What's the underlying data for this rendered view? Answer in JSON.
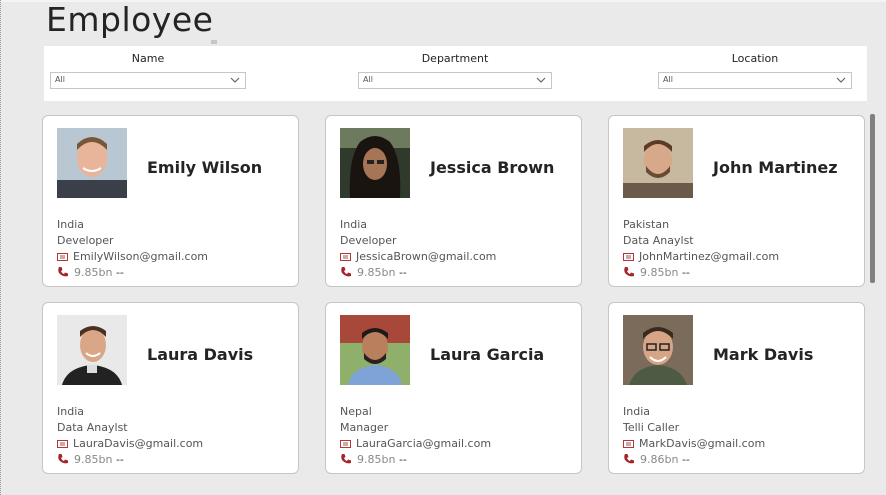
{
  "page": {
    "title": "Employee"
  },
  "filters": [
    {
      "label": "Name",
      "value": "All"
    },
    {
      "label": "Department",
      "value": "All"
    },
    {
      "label": "Location",
      "value": "All"
    }
  ],
  "employees": [
    {
      "name": "Emily Wilson",
      "country": "India",
      "department": "Developer",
      "email": "EmilyWilson@gmail.com",
      "phone_value": "9.85bn",
      "phone_suffix": "--"
    },
    {
      "name": "Jessica Brown",
      "country": "India",
      "department": "Developer",
      "email": "JessicaBrown@gmail.com",
      "phone_value": "9.85bn",
      "phone_suffix": "--"
    },
    {
      "name": "John Martinez",
      "country": "Pakistan",
      "department": "Data Anaylst",
      "email": "JohnMartinez@gmail.com",
      "phone_value": "9.85bn",
      "phone_suffix": "--"
    },
    {
      "name": "Laura Davis",
      "country": "India",
      "department": "Data Anaylst",
      "email": "LauraDavis@gmail.com",
      "phone_value": "9.85bn",
      "phone_suffix": "--"
    },
    {
      "name": "Laura Garcia",
      "country": "Nepal",
      "department": "Manager",
      "email": "LauraGarcia@gmail.com",
      "phone_value": "9.85bn",
      "phone_suffix": "--"
    },
    {
      "name": "Mark Davis",
      "country": "India",
      "department": "Telli Caller",
      "email": "MarkDavis@gmail.com",
      "phone_value": "9.86bn",
      "phone_suffix": "--"
    }
  ],
  "icons": {
    "email": "email-icon",
    "phone": "phone-icon",
    "dropdown": "chevron-down-icon"
  },
  "colors": {
    "background": "#eaeaea",
    "card": "#ffffff",
    "phone_icon": "#a4262c",
    "title": "#252423"
  }
}
